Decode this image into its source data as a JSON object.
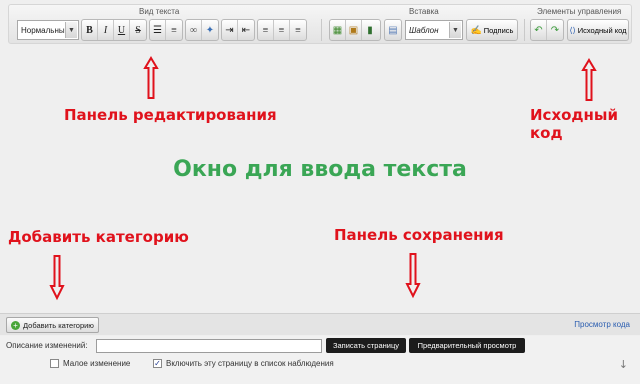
{
  "toolbar": {
    "groups": {
      "text_view": "Вид текста",
      "insert": "Вставка",
      "controls": "Элементы управления"
    },
    "format_select": "Нормальный",
    "buttons": {
      "bold": "B",
      "italic": "I",
      "underline": "U",
      "strike": "S"
    },
    "template_select": "Шаблон",
    "signature_label": "Подпись",
    "source_label": "Исходный код"
  },
  "annotations": {
    "edit_panel": "Панель редактирования",
    "source_code": "Исходный код",
    "text_window": "Окно для ввода текста",
    "add_category": "Добавить категорию",
    "save_panel": "Панель сохранения"
  },
  "category_bar": {
    "add_button": "Добавить категорию",
    "view_code_link": "Просмотр кода"
  },
  "save_panel": {
    "summary_label": "Описание изменений:",
    "summary_value": "",
    "save_button": "Записать страницу",
    "preview_button": "Предварительный просмотр",
    "minor_edit_label": "Малое изменение",
    "minor_edit_checked": false,
    "watch_label": "Включить эту страницу в список наблюдения",
    "watch_checked": true
  },
  "colors": {
    "annotation": "#e0121c",
    "center_title": "#3aa655",
    "link": "#2a5db0"
  }
}
